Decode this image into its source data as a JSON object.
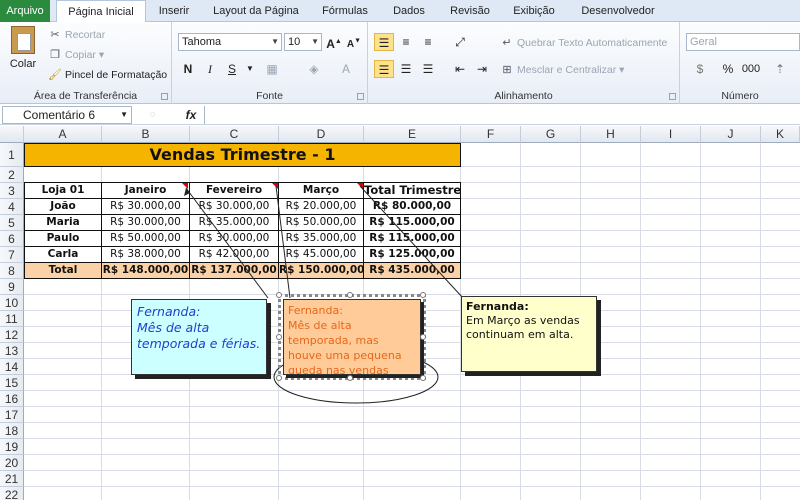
{
  "menu": {
    "tabs": [
      {
        "label": "Arquivo"
      },
      {
        "label": "Página Inicial"
      },
      {
        "label": "Inserir"
      },
      {
        "label": "Layout da Página"
      },
      {
        "label": "Fórmulas"
      },
      {
        "label": "Dados"
      },
      {
        "label": "Revisão"
      },
      {
        "label": "Exibição"
      },
      {
        "label": "Desenvolvedor"
      }
    ]
  },
  "ribbon": {
    "clipboard": {
      "paste": "Colar",
      "cut": "Recortar",
      "copy": "Copiar",
      "format_painter": "Pincel de Formatação",
      "label": "Área de Transferência"
    },
    "font": {
      "name": "Tahoma",
      "size": "10",
      "label": "Fonte"
    },
    "alignment": {
      "wrap_text": "Quebrar Texto Automaticamente",
      "merge_center": "Mesclar e Centralizar",
      "label": "Alinhamento"
    },
    "number": {
      "format": "Geral",
      "percent": "%",
      "thousands": "000",
      "label": "Número"
    }
  },
  "formula_bar": {
    "name_box": "Comentário 6",
    "fx": "fx",
    "value": ""
  },
  "columns": [
    "A",
    "B",
    "C",
    "D",
    "E",
    "F",
    "G",
    "H",
    "I",
    "J",
    "K"
  ],
  "rows": [
    "1",
    "2",
    "3",
    "4",
    "5",
    "6",
    "7",
    "8",
    "9",
    "10",
    "11",
    "12",
    "13",
    "14",
    "15",
    "16",
    "17",
    "18",
    "19",
    "20",
    "21",
    "22"
  ],
  "sheet": {
    "title": "Vendas Trimestre - 1",
    "headers": [
      "Loja 01",
      "Janeiro",
      "Fevereiro",
      "Março",
      "Total Trimestre"
    ],
    "data": [
      [
        "João",
        "R$ 30.000,00",
        "R$ 30.000,00",
        "R$ 20.000,00",
        "R$ 80.000,00"
      ],
      [
        "Maria",
        "R$ 30.000,00",
        "R$ 35.000,00",
        "R$ 50.000,00",
        "R$ 115.000,00"
      ],
      [
        "Paulo",
        "R$ 50.000,00",
        "R$ 30.000,00",
        "R$ 35.000,00",
        "R$ 115.000,00"
      ],
      [
        "Carla",
        "R$ 38.000,00",
        "R$ 42.000,00",
        "R$ 45.000,00",
        "R$ 125.000,00"
      ]
    ],
    "total": [
      "Total",
      "R$ 148.000,00",
      "R$ 137.000,00",
      "R$ 150.000,00",
      "R$ 435.000,00"
    ]
  },
  "comments": [
    {
      "author": "Fernanda:",
      "text": "Mês de alta temporada e férias."
    },
    {
      "author": "Fernanda:",
      "text": "Mês de alta temporada, mas houve uma pequena queda nas vendas"
    },
    {
      "author": "Fernanda:",
      "text": "Em Março as vendas continuam em alta."
    }
  ],
  "colors": {
    "title_bg": "#f5b400",
    "total_bg": "#fbd2a7",
    "comment1_bg": "#ccffff",
    "comment2_bg": "#ffcc99",
    "comment3_bg": "#ffffcc",
    "comment1_text": "#1f3fcc",
    "comment2_text": "#e8661a"
  }
}
